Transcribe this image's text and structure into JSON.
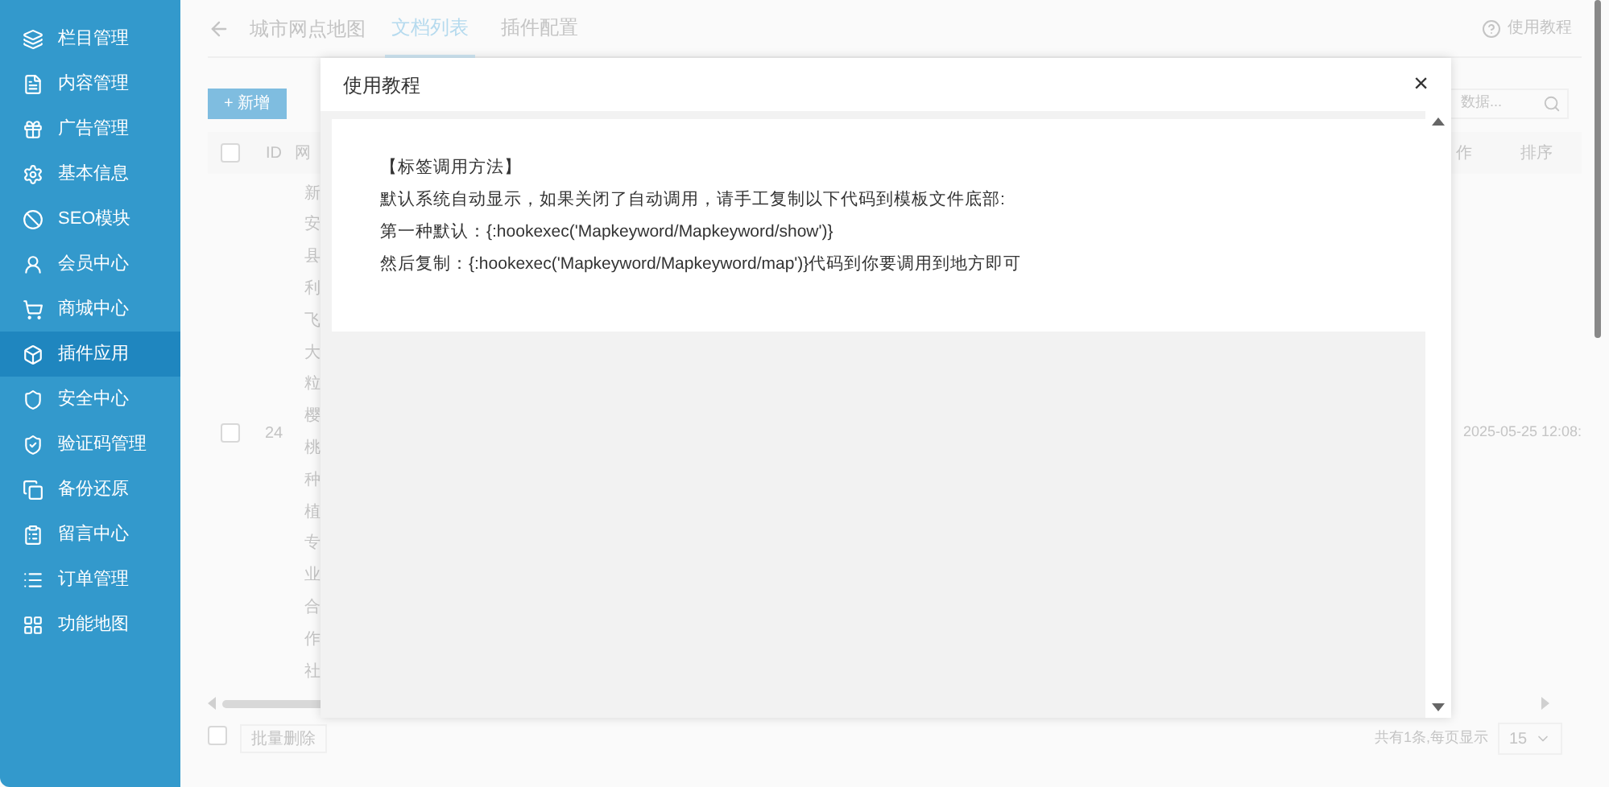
{
  "sidebar": {
    "items": [
      {
        "label": "栏目管理",
        "selected": false
      },
      {
        "label": "内容管理",
        "selected": false
      },
      {
        "label": "广告管理",
        "selected": false
      },
      {
        "label": "基本信息",
        "selected": false
      },
      {
        "label": "SEO模块",
        "selected": false
      },
      {
        "label": "会员中心",
        "selected": false
      },
      {
        "label": "商城中心",
        "selected": false
      },
      {
        "label": "插件应用",
        "selected": true
      },
      {
        "label": "安全中心",
        "selected": false
      },
      {
        "label": "验证码管理",
        "selected": false
      },
      {
        "label": "备份还原",
        "selected": false
      },
      {
        "label": "留言中心",
        "selected": false
      },
      {
        "label": "订单管理",
        "selected": false
      },
      {
        "label": "功能地图",
        "selected": false
      }
    ]
  },
  "header": {
    "title": "城市网点地图",
    "tabs": [
      {
        "label": "文档列表",
        "selected": true
      },
      {
        "label": "插件配置",
        "selected": false
      }
    ],
    "help": "使用教程"
  },
  "toolbar": {
    "add_button": "+ 新增",
    "search": {
      "placeholder": "数据..."
    }
  },
  "table": {
    "select_all_checked": false,
    "columns": [
      "ID",
      "网",
      "作",
      "排序"
    ],
    "rows": [
      {
        "checked": false,
        "id": "24",
        "name": "新安县利飞大粒樱桃种植专业合作社",
        "date": "2025-05-25 12:08:"
      }
    ]
  },
  "footer": {
    "select_all_checked": false,
    "bulk_delete": "批量删除",
    "summary": "共有1条,每页显示",
    "page_size": "15"
  },
  "modal": {
    "title": "使用教程",
    "close": "×",
    "lines": [
      "【标签调用方法】",
      "默认系统自动显示，如果关闭了自动调用，请手工复制以下代码到模板文件底部:",
      "第一种默认：{:hookexec('Mapkeyword/Mapkeyword/show')}",
      "然后复制：{:hookexec('Mapkeyword/Mapkeyword/map')}代码到你要调用到地方即可"
    ]
  }
}
